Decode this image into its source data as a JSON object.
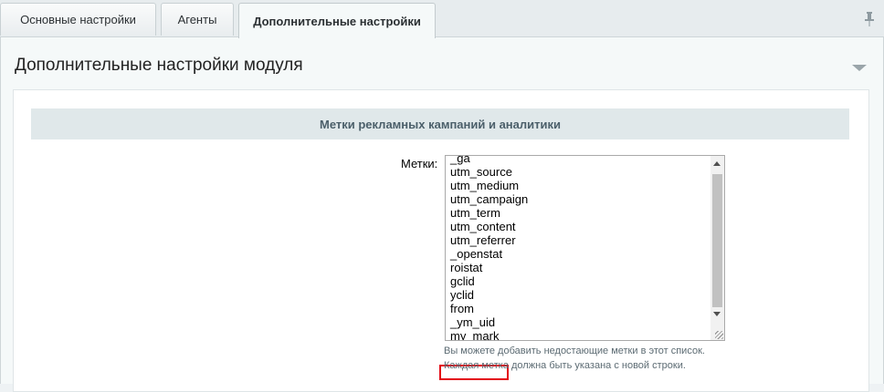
{
  "tabs": [
    {
      "label": "Основные настройки",
      "active": false
    },
    {
      "label": "Агенты",
      "active": false
    },
    {
      "label": "Дополнительные настройки",
      "active": true
    }
  ],
  "icons": {
    "pin": "pin-icon",
    "collapse": "triangle-down-icon"
  },
  "section": {
    "title": "Дополнительные настройки модуля"
  },
  "group": {
    "heading": "Метки рекламных кампаний и аналитики"
  },
  "marks_field": {
    "label": "Метки:",
    "lines": [
      "_ga",
      "utm_source",
      "utm_medium",
      "utm_campaign",
      "utm_term",
      "utm_content",
      "utm_referrer",
      "_openstat",
      "roistat",
      "gclid",
      "yclid",
      "from",
      "_ym_uid",
      "my_mark"
    ],
    "highlighted": "my_mark",
    "highlight_color": "#e30613"
  },
  "hints": [
    "Вы можете добавить недостающие метки в этот список.",
    "Каждая метка должна быть указана с новой строки."
  ]
}
